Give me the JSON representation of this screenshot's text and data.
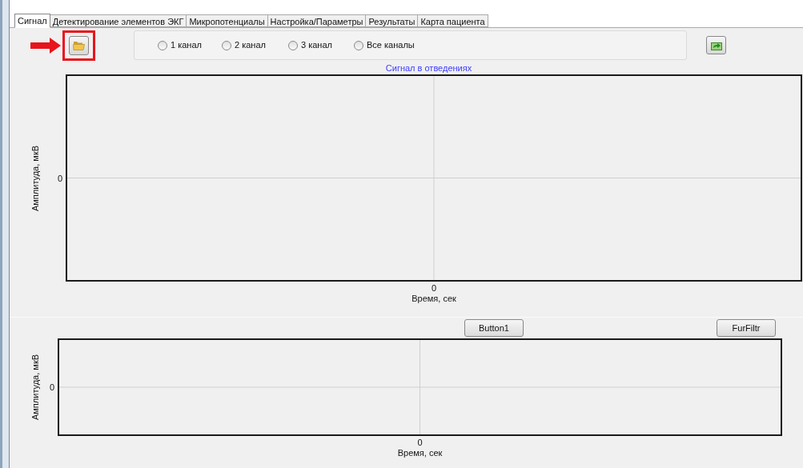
{
  "tabs": [
    {
      "label": "Сигнал",
      "selected": true
    },
    {
      "label": "Детектирование элементов ЭКГ",
      "selected": false
    },
    {
      "label": "Микропотенциалы",
      "selected": false
    },
    {
      "label": "Настройка/Параметры",
      "selected": false
    },
    {
      "label": "Результаты",
      "selected": false
    },
    {
      "label": "Карта пациента",
      "selected": false
    }
  ],
  "channels": [
    {
      "label": "1 канал",
      "selected": false
    },
    {
      "label": "2 канал",
      "selected": false
    },
    {
      "label": "3 канал",
      "selected": false
    },
    {
      "label": "Все каналы",
      "selected": false
    }
  ],
  "signal_chart": {
    "title": "Сигнал в отведениях",
    "ylabel": "Амплитуда, мкВ",
    "xlabel": "Время, сек",
    "y_tick": "0",
    "x_tick": "0"
  },
  "buttons": [
    "Button1",
    "FurFiltr"
  ],
  "filter_chart": {
    "ylabel": "Амплитуда, мкВ",
    "xlabel": "Время, сек",
    "y_tick": "0",
    "x_tick": "0"
  }
}
